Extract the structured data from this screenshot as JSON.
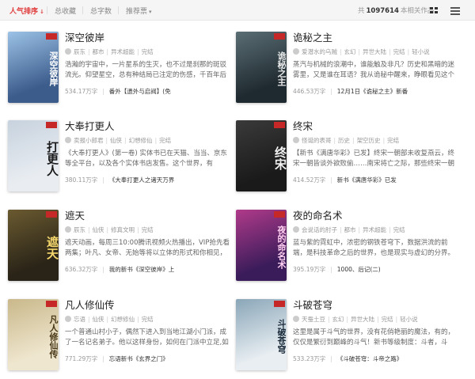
{
  "filters": {
    "tabs": [
      "人气排序",
      "总收藏",
      "总字数",
      "推荐票"
    ],
    "count_prefix": "共",
    "count_value": "1097614",
    "count_suffix": "本相关作品"
  },
  "books": [
    {
      "title": "深空彼岸",
      "author": "辰东",
      "tags": [
        "都市",
        "异术超能",
        "完结"
      ],
      "desc": "浩瀚的宇宙中，一片星系的生灭，也不过是刹那的斑驳流光。仰望星空，总有种结局已注定的伤感，千百年后",
      "words": "534.17万字",
      "update": "番外【遗外与启阀】(免",
      "cover": {
        "text": "深空彼岸",
        "bg": "#3c5c8c",
        "bg2": "#9cc2e6",
        "fg": "#ffffff"
      }
    },
    {
      "title": "诡秘之主",
      "author": "爱潜水的乌贼",
      "tags": [
        "玄幻",
        "异世大陆",
        "完结",
        "轻小说"
      ],
      "desc": "蒸汽与机械的浪潮中，谁能触及非凡？历史和黑暗的迷雾里，又是谁在耳语？我从诡秘中醒来，睁眼看见这个",
      "words": "446.53万字",
      "update": "12月1日《诡秘之主》新番",
      "cover": {
        "text": "诡秘之主",
        "bg": "#1f2a30",
        "bg2": "#5a6e74",
        "fg": "#e8e8e8"
      }
    },
    {
      "title": "大奉打更人",
      "author": "卖报小郎君",
      "tags": [
        "仙侠",
        "幻想修仙",
        "完结"
      ],
      "desc": "《大奉打更人》(第一卷) 实体书已在天猫、当当、京东等全平台，以及各个实体书店发售。这个世界，有",
      "words": "380.11万字",
      "update": "《大奉打更人之诸天万界",
      "cover": {
        "text": "打更人",
        "bg": "#e9edf2",
        "bg2": "#c7d2de",
        "fg": "#1a1a1a"
      }
    },
    {
      "title": "终宋",
      "author": "怪诞的表哥",
      "tags": [
        "历史",
        "架空历史",
        "完结"
      ],
      "desc": "【新书《满唐华彩》已发】终宋一朝部未收复燕云，终宋一朝皆谈外欲败偷……南宋将亡之际，那些终宋一朝",
      "words": "414.52万字",
      "update": "新书《满唐华彩》已发",
      "cover": {
        "text": "终宋",
        "bg": "#1a1a1a",
        "bg2": "#3a3a3a",
        "fg": "#f2f2f2"
      }
    },
    {
      "title": "遮天",
      "author": "辰东",
      "tags": [
        "仙侠",
        "修真文明",
        "完结"
      ],
      "desc": "遮天动画，每周三10:00腾讯视频火热播出，VIP抢先看两集；叶凡、女帝、无始等将以立体的形式和你相见，",
      "words": "636.32万字",
      "update": "我的新书《深空彼岸》上",
      "cover": {
        "text": "遮天",
        "bg": "#2a2418",
        "bg2": "#6a5a30",
        "fg": "#f5d76e"
      }
    },
    {
      "title": "夜的命名术",
      "author": "会说话的肘子",
      "tags": [
        "都市",
        "异术超能",
        "完结"
      ],
      "desc": "蓝与紫的霓虹中，浓密的钢铁苍穹下，数据洪流的前端，是科技革命之后的世界，也是现实与虚幻的分界。",
      "words": "395.19万字",
      "update": "1000、后记(二)",
      "cover": {
        "text": "夜的命名术",
        "bg": "#3a1c5a",
        "bg2": "#b03a8a",
        "fg": "#ffd0f0"
      }
    },
    {
      "title": "凡人修仙传",
      "author": "忘语",
      "tags": [
        "仙侠",
        "幻想修仙",
        "完结"
      ],
      "desc": "一个普通山村小子，偶然下进入到当地江湖小门派，成了一名记名弟子。他以这样身份，如何在门派中立足,如",
      "words": "771.29万字",
      "update": "忘语新书《玄界之门》",
      "cover": {
        "text": "凡人修仙传",
        "bg": "#efe6cf",
        "bg2": "#c9b88a",
        "fg": "#4a3a1a"
      }
    },
    {
      "title": "斗破苍穹",
      "author": "天蚕土豆",
      "tags": [
        "玄幻",
        "异世大陆",
        "完结",
        "轻小说"
      ],
      "desc": "这里是属于斗气的世界，没有花俏艳丽的魔法，有的，仅仅是繁衍到巅峰的斗气！新书等级制度：斗者，斗",
      "words": "533.23万字",
      "update": "《斗破苍穹：斗帝之路》",
      "cover": {
        "text": "斗破苍穹",
        "bg": "#e8eef2",
        "bg2": "#8aa6b8",
        "fg": "#1a2a3a"
      }
    }
  ]
}
